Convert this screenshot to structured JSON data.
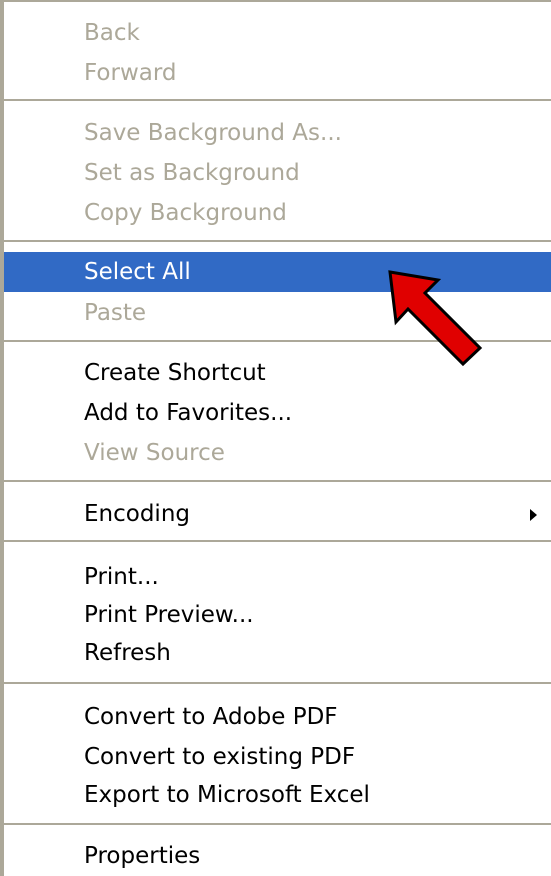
{
  "context_menu": {
    "items": [
      {
        "label": "Back",
        "enabled": false
      },
      {
        "label": "Forward",
        "enabled": false
      },
      {
        "label": "Save Background As...",
        "enabled": false
      },
      {
        "label": "Set as Background",
        "enabled": false
      },
      {
        "label": "Copy Background",
        "enabled": false
      },
      {
        "label": "Select All",
        "enabled": true,
        "highlighted": true
      },
      {
        "label": "Paste",
        "enabled": false
      },
      {
        "label": "Create Shortcut",
        "enabled": true
      },
      {
        "label": "Add to Favorites...",
        "enabled": true
      },
      {
        "label": "View Source",
        "enabled": false
      },
      {
        "label": "Encoding",
        "enabled": true,
        "submenu": true
      },
      {
        "label": "Print...",
        "enabled": true
      },
      {
        "label": "Print Preview...",
        "enabled": true
      },
      {
        "label": "Refresh",
        "enabled": true
      },
      {
        "label": "Convert to Adobe PDF",
        "enabled": true
      },
      {
        "label": "Convert to existing PDF",
        "enabled": true
      },
      {
        "label": "Export to Microsoft Excel",
        "enabled": true
      },
      {
        "label": "Properties",
        "enabled": true
      }
    ]
  },
  "colors": {
    "highlight": "#316ac5",
    "disabled_text": "#aca899",
    "pointer_arrow_fill": "#e00000"
  },
  "icons": {
    "submenu": "triangle-right-icon",
    "pointer": "red-arrow-icon"
  }
}
